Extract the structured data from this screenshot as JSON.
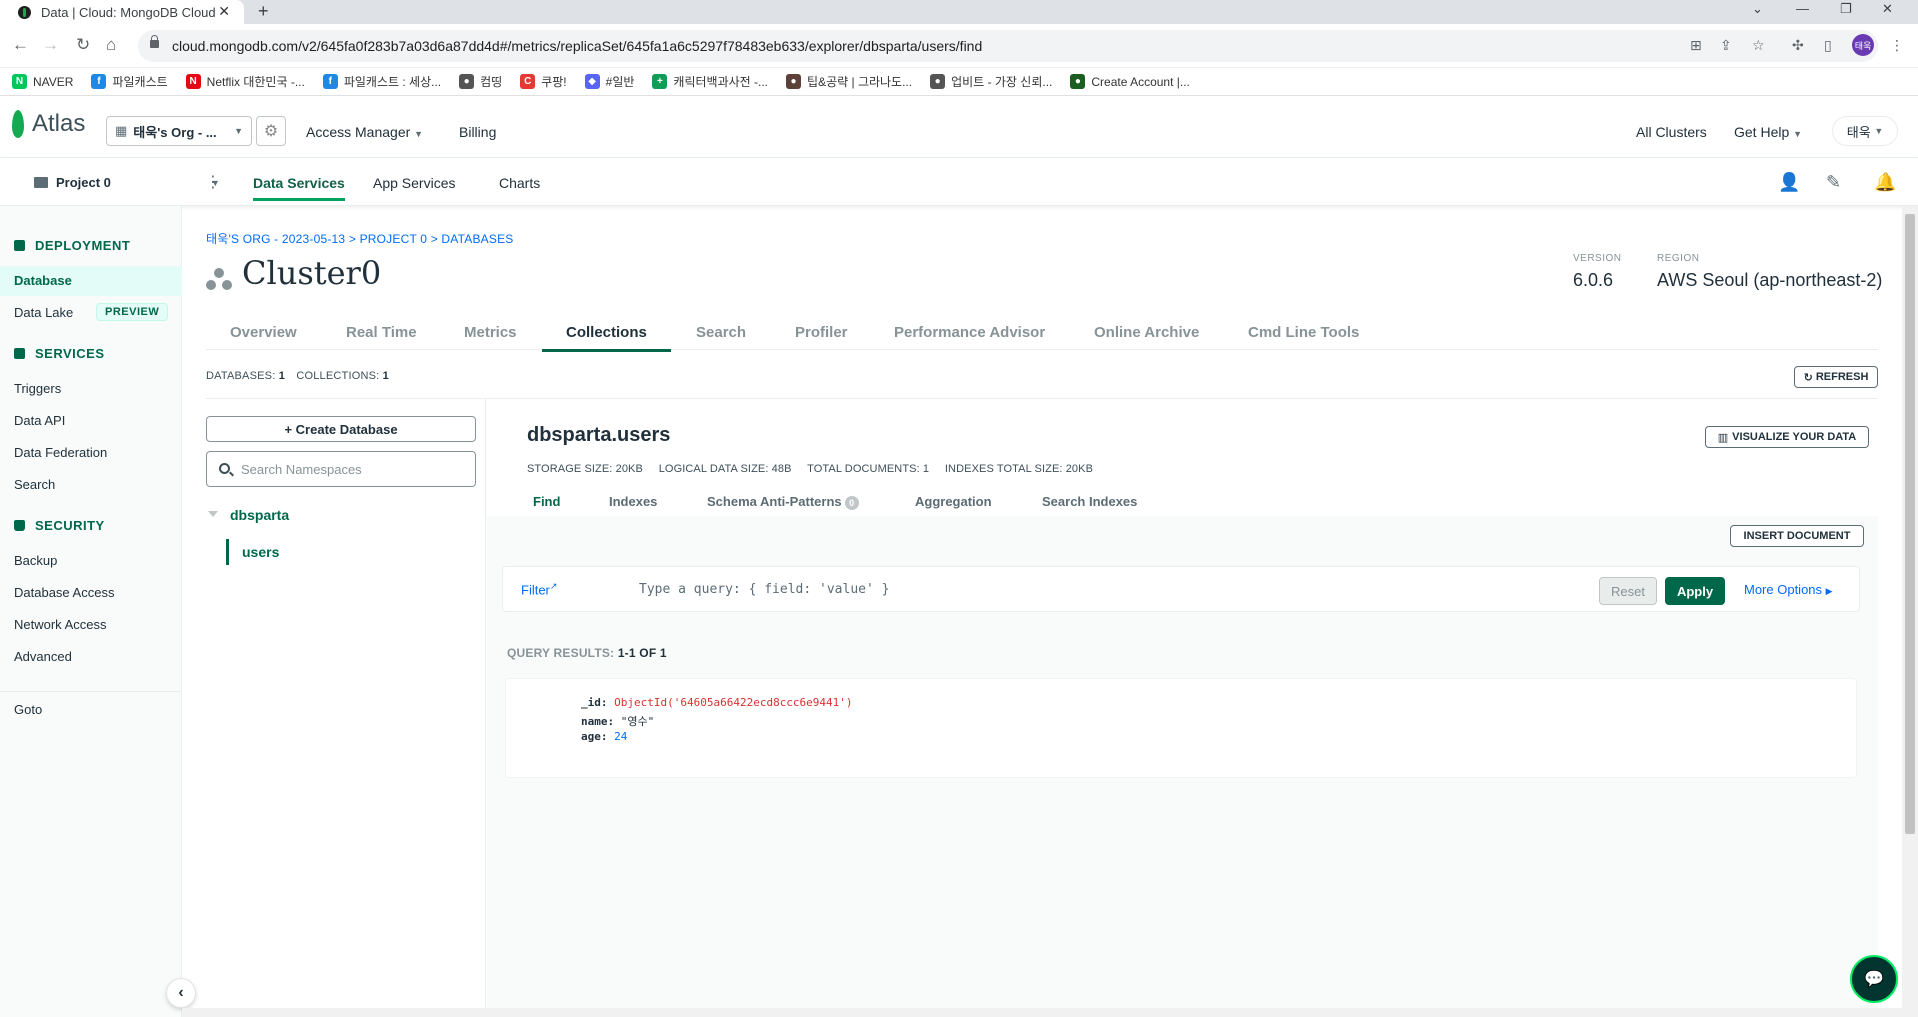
{
  "browser": {
    "tab_title": "Data | Cloud: MongoDB Cloud",
    "url": "cloud.mongodb.com/v2/645fa0f283b7a03d6a87dd4d#/metrics/replicaSet/645fa1a6c5297f78483eb633/explorer/dbsparta/users/find",
    "profile_initials": "태욱",
    "bookmarks": [
      {
        "label": "NAVER",
        "icon": "N",
        "color": "#03c75a"
      },
      {
        "label": "파일캐스트",
        "icon": "f",
        "color": "#1e88e5"
      },
      {
        "label": "Netflix 대한민국 -...",
        "icon": "N",
        "color": "#e50914"
      },
      {
        "label": "파일캐스트 : 세상...",
        "icon": "f",
        "color": "#1e88e5"
      },
      {
        "label": "컴띵",
        "icon": "●",
        "color": "#555555"
      },
      {
        "label": "쿠팡!",
        "icon": "C",
        "color": "#e53935"
      },
      {
        "label": "#일반",
        "icon": "◆",
        "color": "#5865f2"
      },
      {
        "label": "캐릭터백과사전 -...",
        "icon": "+",
        "color": "#0f9d58"
      },
      {
        "label": "팁&공략 | 그라나도...",
        "icon": "●",
        "color": "#5d4037"
      },
      {
        "label": "업비트 - 가장 신뢰...",
        "icon": "●",
        "color": "#555555"
      },
      {
        "label": "Create Account |...",
        "icon": "●",
        "color": "#1b5e20"
      }
    ]
  },
  "topnav": {
    "brand": "Atlas",
    "org": "태욱's Org - ...",
    "access_manager": "Access Manager",
    "billing": "Billing",
    "all_clusters": "All Clusters",
    "get_help": "Get Help",
    "user": "태욱"
  },
  "projnav": {
    "project": "Project 0",
    "tabs": [
      "Data Services",
      "App Services",
      "Charts"
    ]
  },
  "sidebar": {
    "deployment": "DEPLOYMENT",
    "database": "Database",
    "data_lake": "Data Lake",
    "preview": "PREVIEW",
    "services": "SERVICES",
    "triggers": "Triggers",
    "data_api": "Data API",
    "data_federation": "Data Federation",
    "search": "Search",
    "security": "SECURITY",
    "backup": "Backup",
    "database_access": "Database Access",
    "network_access": "Network Access",
    "advanced": "Advanced",
    "goto": "Goto"
  },
  "main": {
    "breadcrumb": "태욱'S ORG - 2023-05-13 > PROJECT 0 > DATABASES",
    "cluster": "Cluster0",
    "version_label": "VERSION",
    "version": "6.0.6",
    "region_label": "REGION",
    "region": "AWS Seoul (ap-northeast-2)",
    "tabs": [
      "Overview",
      "Real Time",
      "Metrics",
      "Collections",
      "Search",
      "Profiler",
      "Performance Advisor",
      "Online Archive",
      "Cmd Line Tools"
    ],
    "databases_label": "DATABASES:",
    "databases_count": "1",
    "collections_label": "COLLECTIONS:",
    "collections_count": "1",
    "refresh": "REFRESH",
    "create_database": "+ Create Database",
    "search_ns_placeholder": "Search Namespaces",
    "db_name": "dbsparta",
    "coll_name": "users"
  },
  "collection": {
    "namespace": "dbsparta.users",
    "storage_size": "STORAGE SIZE: 20KB",
    "logical_size": "LOGICAL DATA SIZE: 48B",
    "total_docs": "TOTAL DOCUMENTS: 1",
    "indexes_size": "INDEXES TOTAL SIZE: 20KB",
    "visualize": "VISUALIZE YOUR DATA",
    "subtabs": [
      "Find",
      "Indexes",
      "Schema Anti-Patterns",
      "Aggregation",
      "Search Indexes"
    ],
    "antipattern_count": "0",
    "insert_document": "INSERT DOCUMENT",
    "filter": "Filter",
    "query_placeholder": "Type a query: { field: 'value' }",
    "reset": "Reset",
    "apply": "Apply",
    "more_options": "More Options",
    "query_results_label": "QUERY RESULTS:",
    "query_results_value": "1-1 OF 1",
    "document": {
      "id_key": "_id:",
      "id_value": "ObjectId('64605a66422ecd8ccc6e9441')",
      "name_key": "name:",
      "name_value": "\"영수\"",
      "age_key": "age:",
      "age_value": "24"
    }
  }
}
